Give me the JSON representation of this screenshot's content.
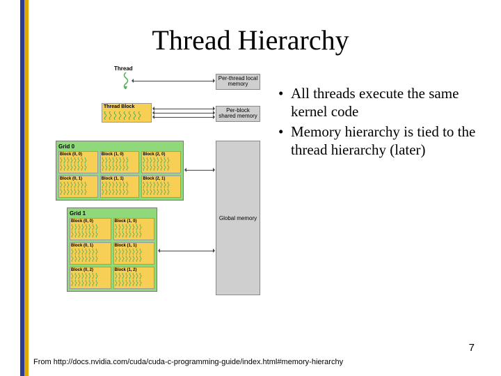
{
  "title": "Thread Hierarchy",
  "bullets": [
    "All threads execute the same kernel code",
    "Memory hierarchy is tied to the thread hierarchy (later)"
  ],
  "slide_number": "7",
  "citation": "From http://docs.nvidia.com/cuda/cuda-c-programming-guide/index.html#memory-hierarchy",
  "diagram": {
    "thread_label": "Thread",
    "thread_block_label": "Thread Block",
    "per_thread_mem": "Per-thread local memory",
    "per_block_mem": "Per-block shared memory",
    "global_mem": "Global memory",
    "grid0": {
      "label": "Grid 0",
      "blocks": [
        "Block (0, 0)",
        "Block (1, 0)",
        "Block (2, 0)",
        "Block (0, 1)",
        "Block (1, 1)",
        "Block (2, 1)"
      ]
    },
    "grid1": {
      "label": "Grid 1",
      "blocks": [
        "Block (0, 0)",
        "Block (1, 0)",
        "Block (0, 1)",
        "Block (1, 1)",
        "Block (0, 2)",
        "Block (1, 2)"
      ]
    }
  }
}
